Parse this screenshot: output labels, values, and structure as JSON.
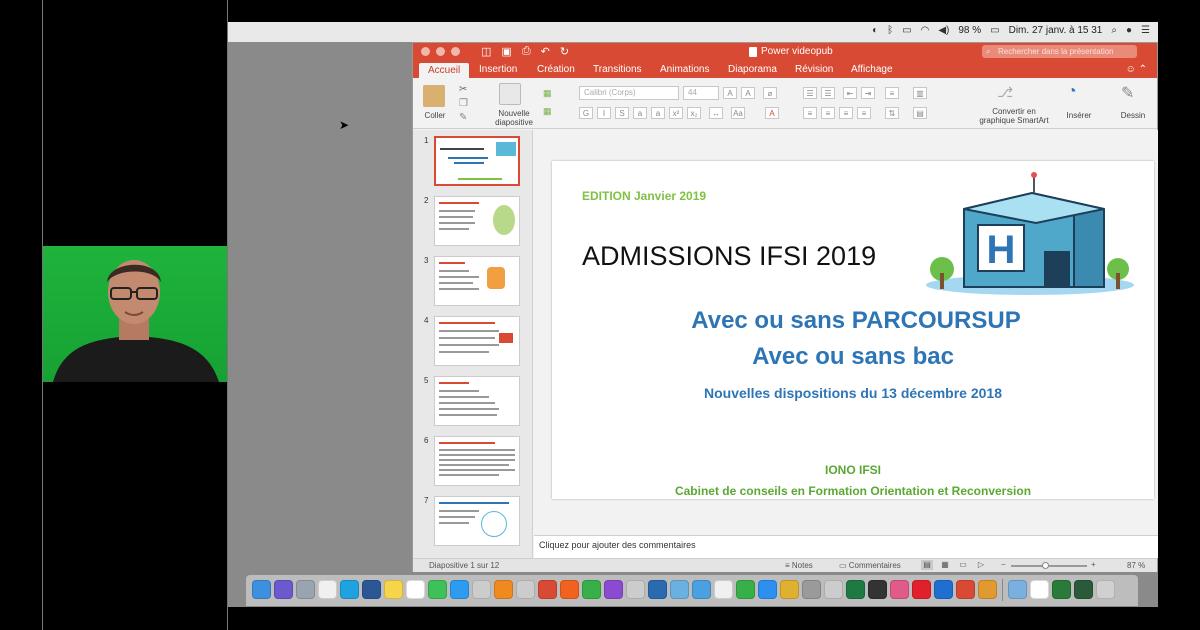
{
  "menubar": {
    "battery": "98 %",
    "datetime": "Dim. 27 janv. à  15 31",
    "icons": [
      "moon-icon",
      "bluetooth-icon",
      "cast-icon",
      "wifi-icon",
      "volume-icon",
      "battery-icon",
      "search-icon",
      "user-icon",
      "list-icon"
    ]
  },
  "window": {
    "title": "Power videopub",
    "search_placeholder": "Rechercher dans la présentation"
  },
  "tabs": [
    "Accueil",
    "Insertion",
    "Création",
    "Transitions",
    "Animations",
    "Diaporama",
    "Révision",
    "Affichage"
  ],
  "ribbon": {
    "paste": "Coller",
    "new_slide_1": "Nouvelle",
    "new_slide_2": "diapositive",
    "font_name": "Calibri (Corps)",
    "font_size": "44",
    "smartart_1": "Convertir en",
    "smartart_2": "graphique SmartArt",
    "insert": "Insérer",
    "draw": "Dessin"
  },
  "thumbnails": [
    "1",
    "2",
    "3",
    "4",
    "5",
    "6",
    "7"
  ],
  "slide": {
    "edition": "EDITION Janvier 2019",
    "title": "ADMISSIONS IFSI 2019",
    "subtitle1": "Avec ou sans PARCOURSUP",
    "subtitle2": "Avec ou sans bac",
    "subtitle3": "Nouvelles dispositions du 13 décembre 2018",
    "org": "IONO IFSI",
    "org_desc": "Cabinet de conseils en Formation Orientation et Reconversion",
    "hospital_letter": "H"
  },
  "notes_placeholder": "Cliquez pour ajouter des commentaires",
  "statusbar": {
    "slide_count": "Diapositive 1 sur 12",
    "notes": "Notes",
    "comments": "Commentaires",
    "zoom": "87 %",
    "zoom_level": 0.45
  },
  "colors": {
    "ppt_red": "#d84a33",
    "title_blue": "#2e75b6",
    "green": "#5aa832",
    "webcam_green": "#1fb33c"
  }
}
